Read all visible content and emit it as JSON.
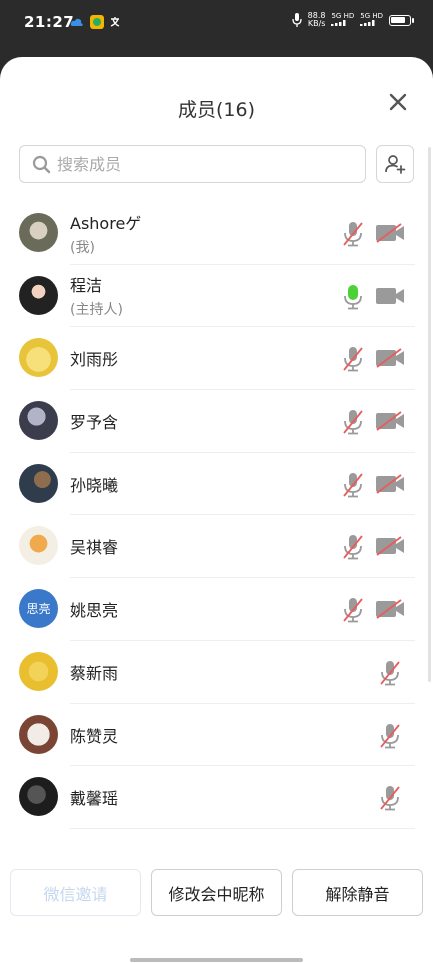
{
  "status_bar": {
    "time": "21:27",
    "speed_value": "88.8",
    "speed_unit": "KB/s",
    "signal_1": "5G HD",
    "signal_2": "5G HD"
  },
  "sheet": {
    "title": "成员(16)",
    "close_icon": "close-icon",
    "search_placeholder": "搜索成员",
    "add_member_icon": "add-user-icon"
  },
  "members": [
    {
      "name": "Ashoreゲ",
      "role": "(我)",
      "mic": "muted",
      "camera": "off",
      "avatar": "photo"
    },
    {
      "name": "程洁",
      "role": "(主持人)",
      "mic": "active",
      "camera": "on",
      "avatar": "photo"
    },
    {
      "name": "刘雨彤",
      "role": "",
      "mic": "muted",
      "camera": "off",
      "avatar": "cartoon"
    },
    {
      "name": "罗予含",
      "role": "",
      "mic": "muted",
      "camera": "off",
      "avatar": "photo"
    },
    {
      "name": "孙晓曦",
      "role": "",
      "mic": "muted",
      "camera": "off",
      "avatar": "photo"
    },
    {
      "name": "吴祺睿",
      "role": "",
      "mic": "muted",
      "camera": "off",
      "avatar": "cartoon"
    },
    {
      "name": "姚思亮",
      "role": "",
      "mic": "muted",
      "camera": "off",
      "avatar": "text",
      "avatar_text": "思亮"
    },
    {
      "name": "蔡新雨",
      "role": "",
      "mic": "muted",
      "camera": "none",
      "avatar": "cartoon"
    },
    {
      "name": "陈赞灵",
      "role": "",
      "mic": "muted",
      "camera": "none",
      "avatar": "cartoon"
    },
    {
      "name": "戴馨瑶",
      "role": "",
      "mic": "muted",
      "camera": "none",
      "avatar": "photo"
    }
  ],
  "buttons": {
    "invite": "微信邀请",
    "rename": "修改会中昵称",
    "unmute_all": "解除静音"
  },
  "colors": {
    "accent_green": "#4cd137",
    "muted_red": "#e85c5c",
    "icon_grey": "#9a9a9a",
    "avatar_blue": "#3a78c9"
  }
}
